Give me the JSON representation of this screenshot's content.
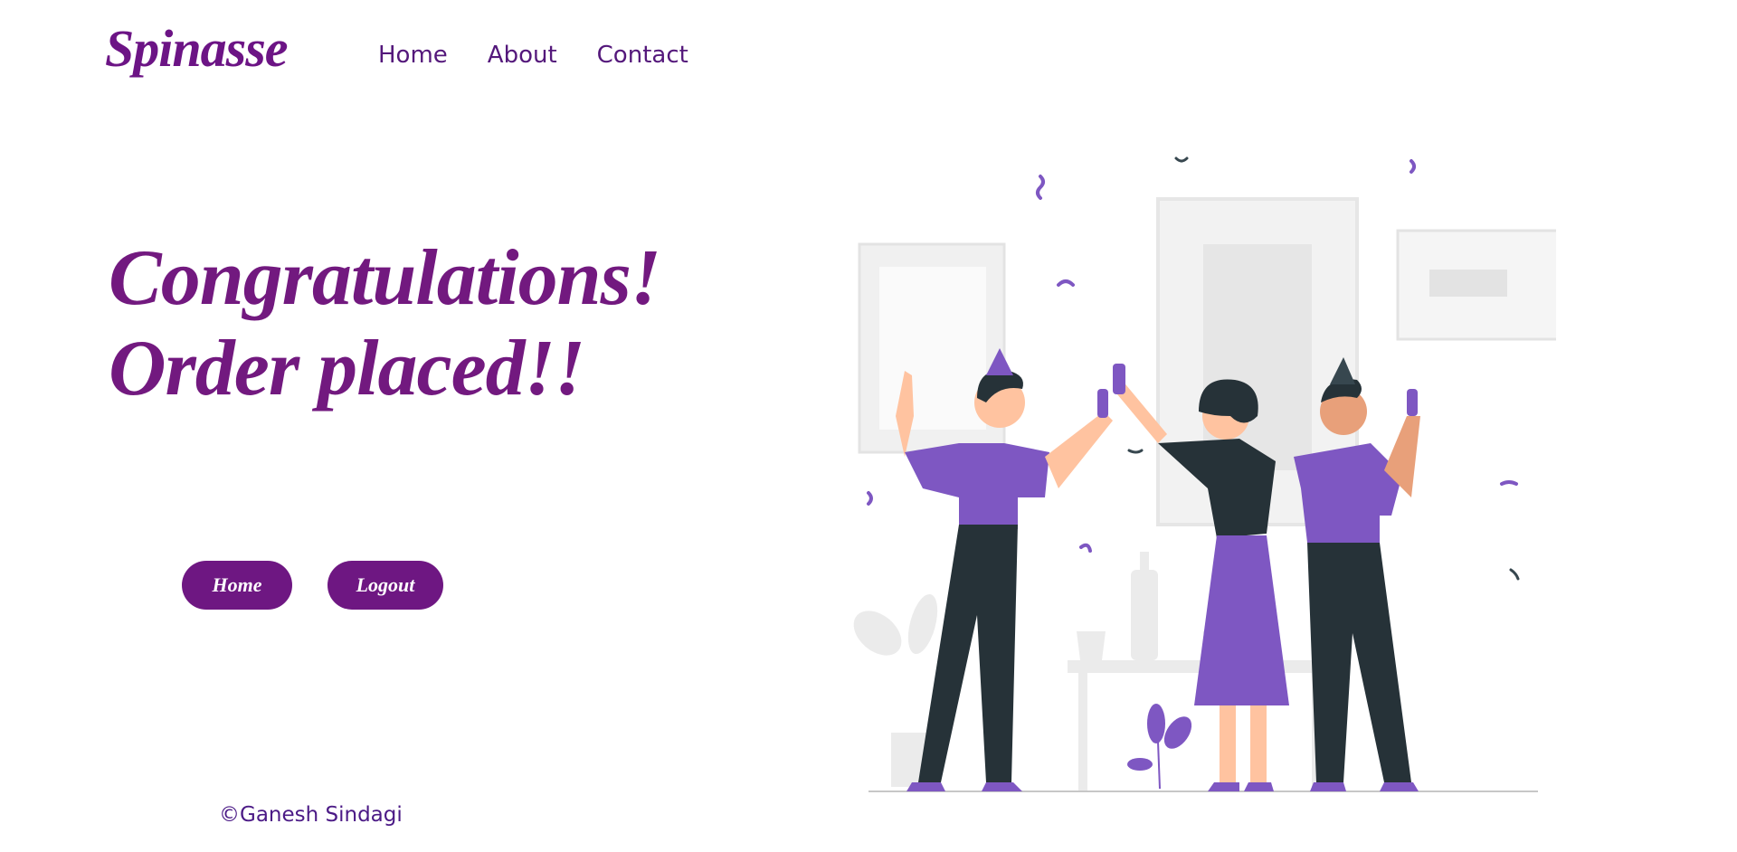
{
  "header": {
    "brand": "Spinasse",
    "nav": [
      {
        "label": "Home"
      },
      {
        "label": "About"
      },
      {
        "label": "Contact"
      }
    ]
  },
  "main": {
    "headline_line1": "Congratulations!",
    "headline_line2": "Order placed!!",
    "home_button": "Home",
    "logout_button": "Logout"
  },
  "footer": {
    "copyright": "©Ganesh Sindagi"
  },
  "illustration": {
    "icon": "celebration-illustration",
    "colors": {
      "purple": "#7e57c2",
      "dark": "#263238",
      "skin": "#ffc3a0",
      "skin_dark": "#e8a07a",
      "gray": "#ebebeb"
    }
  }
}
